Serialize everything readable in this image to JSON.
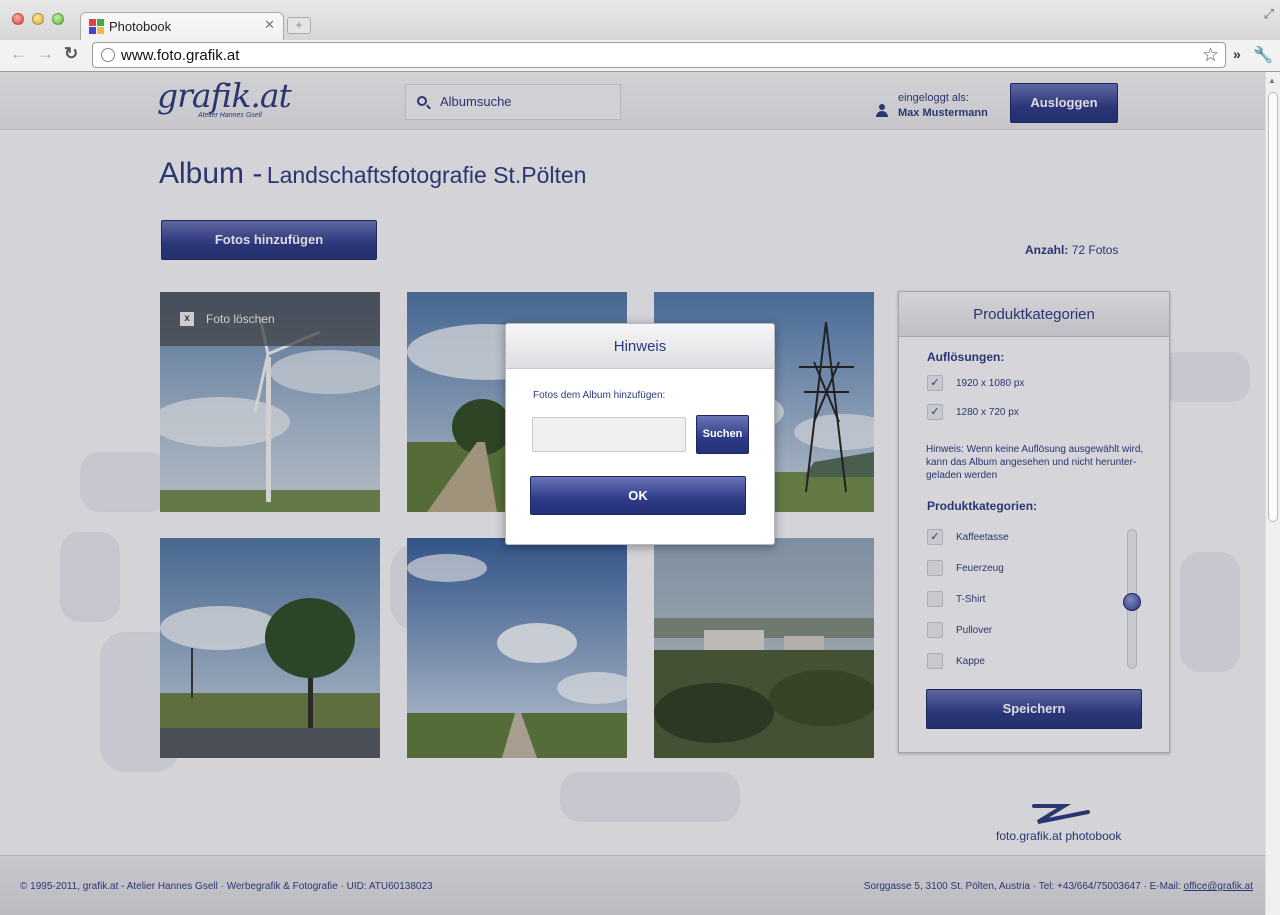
{
  "browser": {
    "tab_title": "Photobook",
    "url": "www.foto.grafik.at"
  },
  "header": {
    "logo_text": "grafik.at",
    "logo_subtitle": "Atelier Hannes Gsell",
    "search_placeholder": "Albumsuche",
    "login_label": "eingeloggt als:",
    "user_name": "Max Mustermann",
    "logout_label": "Ausloggen"
  },
  "album": {
    "title_prefix": "Album -",
    "title_name": "Landschaftsfotografie St.Pölten",
    "add_photos_label": "Fotos hinzufügen",
    "count_label": "Anzahl:",
    "count_value": "72 Fotos",
    "delete_photo_label": "Foto löschen"
  },
  "panel": {
    "title": "Produktkategorien",
    "resolutions_heading": "Auflösungen:",
    "resolutions": [
      {
        "label": "1920 x 1080 px",
        "checked": true
      },
      {
        "label": "1280 x 720 px",
        "checked": true
      }
    ],
    "note": "Hinweis: Wenn keine Auflösung ausgewählt wird, kann das Album angesehen und nicht herunter-geladen werden",
    "categories_heading": "Produktkategorien:",
    "categories": [
      {
        "label": "Kaffeetasse",
        "checked": true
      },
      {
        "label": "Feuerzeug",
        "checked": false
      },
      {
        "label": "T-Shirt",
        "checked": false
      },
      {
        "label": "Pullover",
        "checked": false
      },
      {
        "label": "Kappe",
        "checked": false
      }
    ],
    "save_label": "Speichern"
  },
  "dialog": {
    "title": "Hinweis",
    "label": "Fotos dem Album hinzufügen:",
    "search_label": "Suchen",
    "ok_label": "OK"
  },
  "footer": {
    "brand": "foto.grafik.at photobook",
    "left": "© 1995-2011, grafik.at - Atelier Hannes Gsell · Werbegrafik & Fotografie · UID: ATU60138023",
    "right_prefix": "Sorggasse 5, 3100 St. Pölten, Austria · Tel: +43/664/75003647 · E-Mail:",
    "email": "office@grafik.at"
  },
  "colors": {
    "accent": "#2c3a7a",
    "button": "#2d3a87"
  }
}
